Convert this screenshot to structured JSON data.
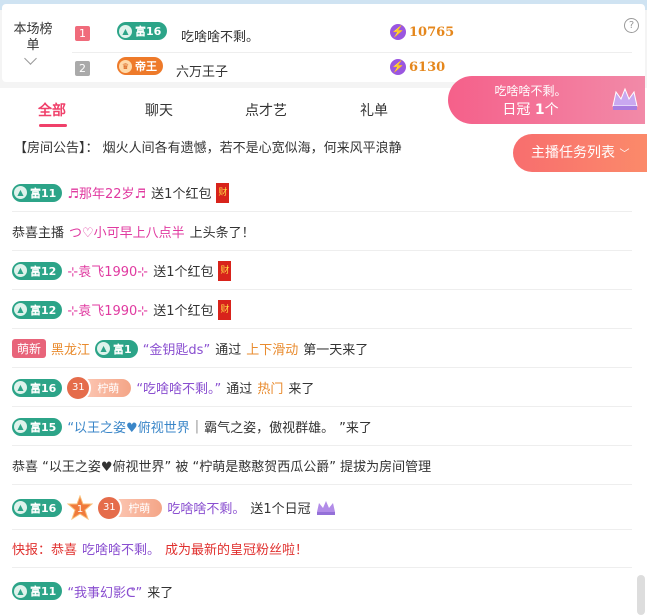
{
  "rank": {
    "label": "本场榜单",
    "rows": [
      {
        "num": "1",
        "badge_text": "富16",
        "badge_type": "rich",
        "name": "吃啥啥不剩。",
        "score": "10765"
      },
      {
        "num": "2",
        "badge_text": "帝王",
        "badge_type": "king",
        "name": "六万王子",
        "score": "6130"
      }
    ],
    "help": "?"
  },
  "tabs": [
    "全部",
    "聊天",
    "点才艺",
    "礼单"
  ],
  "crown_popup": {
    "name": "吃啥啥不剩。",
    "count_prefix": "日冠",
    "count_num": "1",
    "count_suffix": "个"
  },
  "notice": "【房间公告】：  烟火人间各有遗憾，若不是心宽似海，何来风平浪静",
  "task_button": "主播任务列表",
  "messages": {
    "m1": {
      "badge": "富11",
      "user": "♬那年22岁♬",
      "action": "送1个红包",
      "env": "财"
    },
    "m2": {
      "pre": "恭喜主播",
      "user": "つ♡小可早上八点半",
      "action": "上头条了！"
    },
    "m3": {
      "badge": "富12",
      "user": "⊹袁飞1990⊹",
      "action": "送1个红包",
      "env": "财"
    },
    "m4": {
      "badge": "富12",
      "user": "⊹袁飞1990⊹",
      "action": "送1个红包",
      "env": "财"
    },
    "m5": {
      "tag": "萌新",
      "place": "黑龙江",
      "badge": "富1",
      "user": "“金钥匙ds”",
      "via": "通过",
      "src": "上下滑动",
      "action": "第一天来了"
    },
    "m6": {
      "badge": "富16",
      "fan_lvl": "31",
      "fan_name": "柠萌",
      "user": "“吃啥啥不剩。”",
      "via": "通过",
      "src": "热门",
      "action": "来了"
    },
    "m7": {
      "badge": "富15",
      "user": "“以王之姿♥俯视世界",
      "sep": "|",
      "sign": "霸气之姿，傲视群雄。",
      "action": "”来了"
    },
    "m8": {
      "text": "恭喜 “以王之姿♥俯视世界” 被 “柠萌是憨憨贺西瓜公爵” 提拔为房间管理"
    },
    "m9": {
      "badge": "富16",
      "star_num": "1",
      "fan_lvl": "31",
      "fan_name": "柠萌",
      "user": "吃啥啥不剩。",
      "action": "送1个日冠"
    },
    "m10": {
      "pre": "快报：恭喜",
      "user": "吃啥啥不剩。",
      "post": "成为最新的皇冠粉丝啦！"
    },
    "m11": {
      "badge": "富11",
      "user": "“我事幻影ᕦ”",
      "action": "来了"
    }
  }
}
